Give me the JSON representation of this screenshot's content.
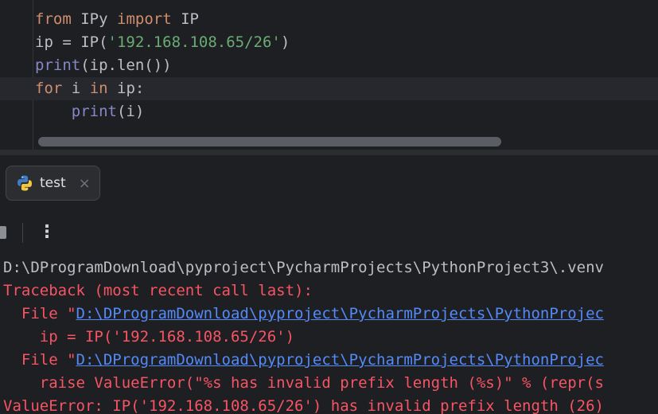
{
  "editor": {
    "lines": [
      {
        "kw": "from",
        "name": "IPy",
        "kw2": "import",
        "name2": "IP"
      },
      {
        "lhs": "ip = IP(",
        "str": "'192.168.108.65/26'",
        "rhs": ")"
      },
      {
        "fn": "print",
        "rest": "(ip.len())"
      },
      {
        "kw": "for",
        "a": "i",
        "kw2": "in",
        "b": "ip:"
      },
      {
        "indent": "    ",
        "fn": "print",
        "rest": "(i)"
      }
    ]
  },
  "tab": {
    "label": "test",
    "close": "×"
  },
  "toolbar": {
    "more": "⋮"
  },
  "console": {
    "cmd": "D:\\DProgramDownload\\pyproject\\PycharmProjects\\PythonProject3\\.venv",
    "traceback": "Traceback (most recent call last):",
    "file1_prefix": "  File \"",
    "file1_link": "D:\\DProgramDownload\\pyproject\\PycharmProjects\\PythonProjec",
    "code1": "    ip = IP('192.168.108.65/26')",
    "file2_prefix": "  File \"",
    "file2_link": "D:\\DProgramDownload\\pyproject\\PycharmProjects\\PythonProjec",
    "code2": "    raise ValueError(\"%s has invalid prefix length (%s)\" % (repr(s",
    "error": "ValueError: IP('192.168.108.65/26') has invalid prefix length (26)"
  },
  "colors": {
    "background": "#1e1f22",
    "keyword": "#cf8e6d",
    "string": "#6aab73",
    "builtin": "#8888c6",
    "error": "#f75464",
    "link": "#548af7"
  }
}
